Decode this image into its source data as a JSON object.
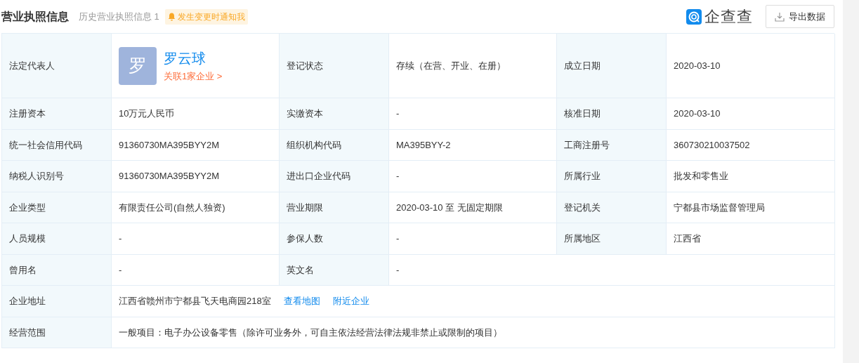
{
  "header": {
    "title": "营业执照信息",
    "history": "历史营业执照信息 1",
    "notify": "发生变更时通知我",
    "logo_text": "企查查",
    "export": "导出数据"
  },
  "rows": [
    {
      "cells": [
        {
          "kind": "label",
          "text": "法定代表人"
        },
        {
          "kind": "person",
          "avatar": "罗",
          "name": "罗云球",
          "link": "关联1家企业 >"
        },
        {
          "kind": "label",
          "text": "登记状态"
        },
        {
          "kind": "value",
          "text": "存续（在营、开业、在册）"
        },
        {
          "kind": "label",
          "text": "成立日期"
        },
        {
          "kind": "value",
          "text": "2020-03-10"
        }
      ]
    },
    {
      "cells": [
        {
          "kind": "label",
          "text": "注册资本"
        },
        {
          "kind": "value",
          "text": "10万元人民币"
        },
        {
          "kind": "label",
          "text": "实缴资本"
        },
        {
          "kind": "value",
          "text": "-"
        },
        {
          "kind": "label",
          "text": "核准日期"
        },
        {
          "kind": "value",
          "text": "2020-03-10"
        }
      ]
    },
    {
      "cells": [
        {
          "kind": "label",
          "text": "统一社会信用代码"
        },
        {
          "kind": "value",
          "text": "91360730MA395BYY2M"
        },
        {
          "kind": "label",
          "text": "组织机构代码"
        },
        {
          "kind": "value",
          "text": "MA395BYY-2"
        },
        {
          "kind": "label",
          "text": "工商注册号"
        },
        {
          "kind": "value",
          "text": "360730210037502"
        }
      ]
    },
    {
      "cells": [
        {
          "kind": "label",
          "text": "纳税人识别号"
        },
        {
          "kind": "value",
          "text": "91360730MA395BYY2M"
        },
        {
          "kind": "label",
          "text": "进出口企业代码"
        },
        {
          "kind": "value",
          "text": "-"
        },
        {
          "kind": "label",
          "text": "所属行业"
        },
        {
          "kind": "value",
          "text": "批发和零售业"
        }
      ]
    },
    {
      "cells": [
        {
          "kind": "label",
          "text": "企业类型"
        },
        {
          "kind": "value",
          "text": "有限责任公司(自然人独资)"
        },
        {
          "kind": "label",
          "text": "营业期限"
        },
        {
          "kind": "value",
          "text": "2020-03-10 至 无固定期限"
        },
        {
          "kind": "label",
          "text": "登记机关"
        },
        {
          "kind": "value",
          "text": "宁都县市场监督管理局"
        }
      ]
    },
    {
      "cells": [
        {
          "kind": "label",
          "text": "人员规模"
        },
        {
          "kind": "value",
          "text": "-"
        },
        {
          "kind": "label",
          "text": "参保人数"
        },
        {
          "kind": "value",
          "text": "-"
        },
        {
          "kind": "label",
          "text": "所属地区"
        },
        {
          "kind": "value",
          "text": "江西省"
        }
      ]
    },
    {
      "cells": [
        {
          "kind": "label",
          "text": "曾用名"
        },
        {
          "kind": "value",
          "text": "-"
        },
        {
          "kind": "label",
          "text": "英文名"
        },
        {
          "kind": "value",
          "text": "-"
        }
      ]
    },
    {
      "cells": [
        {
          "kind": "label",
          "text": "企业地址"
        },
        {
          "kind": "address",
          "text": "江西省赣州市宁都县飞天电商园218室",
          "links": [
            "查看地图",
            "附近企业"
          ]
        }
      ]
    },
    {
      "cells": [
        {
          "kind": "label",
          "text": "经营范围"
        },
        {
          "kind": "value",
          "text": "一般项目：电子办公设备零售（除许可业务外，可自主依法经营法律法规非禁止或限制的项目）"
        }
      ]
    }
  ]
}
